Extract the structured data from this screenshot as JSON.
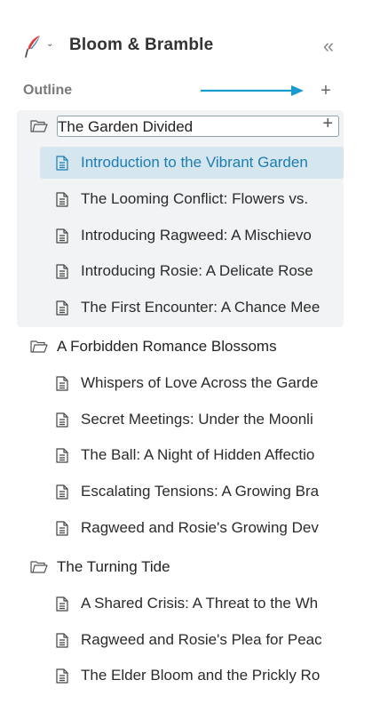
{
  "app": {
    "title": "Bloom & Bramble",
    "collapse_symbol": "«",
    "logo_icon": "quill-feather-icon"
  },
  "outline": {
    "label": "Outline",
    "add_symbol": "+"
  },
  "colors": {
    "accent": "#1b7db3",
    "arrow": "#1a9bd0",
    "selected_bg": "#d6e6ee",
    "group_bg": "#f1f3f4"
  },
  "chapters": [
    {
      "title": "The Garden Divided",
      "editing": true,
      "add_symbol": "+",
      "items": [
        {
          "label": "Introduction to the Vibrant Garden",
          "selected": true
        },
        {
          "label": "The Looming Conflict: Flowers vs."
        },
        {
          "label": "Introducing Ragweed: A Mischievo"
        },
        {
          "label": "Introducing Rosie: A Delicate Rose"
        },
        {
          "label": "The First Encounter: A Chance Mee"
        }
      ]
    },
    {
      "title": "A Forbidden Romance Blossoms",
      "items": [
        {
          "label": "Whispers of Love Across the Garde"
        },
        {
          "label": "Secret Meetings: Under the Moonli"
        },
        {
          "label": "The Ball: A Night of Hidden Affectio"
        },
        {
          "label": "Escalating Tensions: A Growing Bra"
        },
        {
          "label": "Ragweed and Rosie's Growing Dev"
        }
      ]
    },
    {
      "title": "The Turning Tide",
      "items": [
        {
          "label": "A Shared Crisis: A Threat to the Wh"
        },
        {
          "label": "Ragweed and Rosie's Plea for Peac"
        },
        {
          "label": "The Elder Bloom and the Prickly Ro"
        }
      ]
    }
  ]
}
